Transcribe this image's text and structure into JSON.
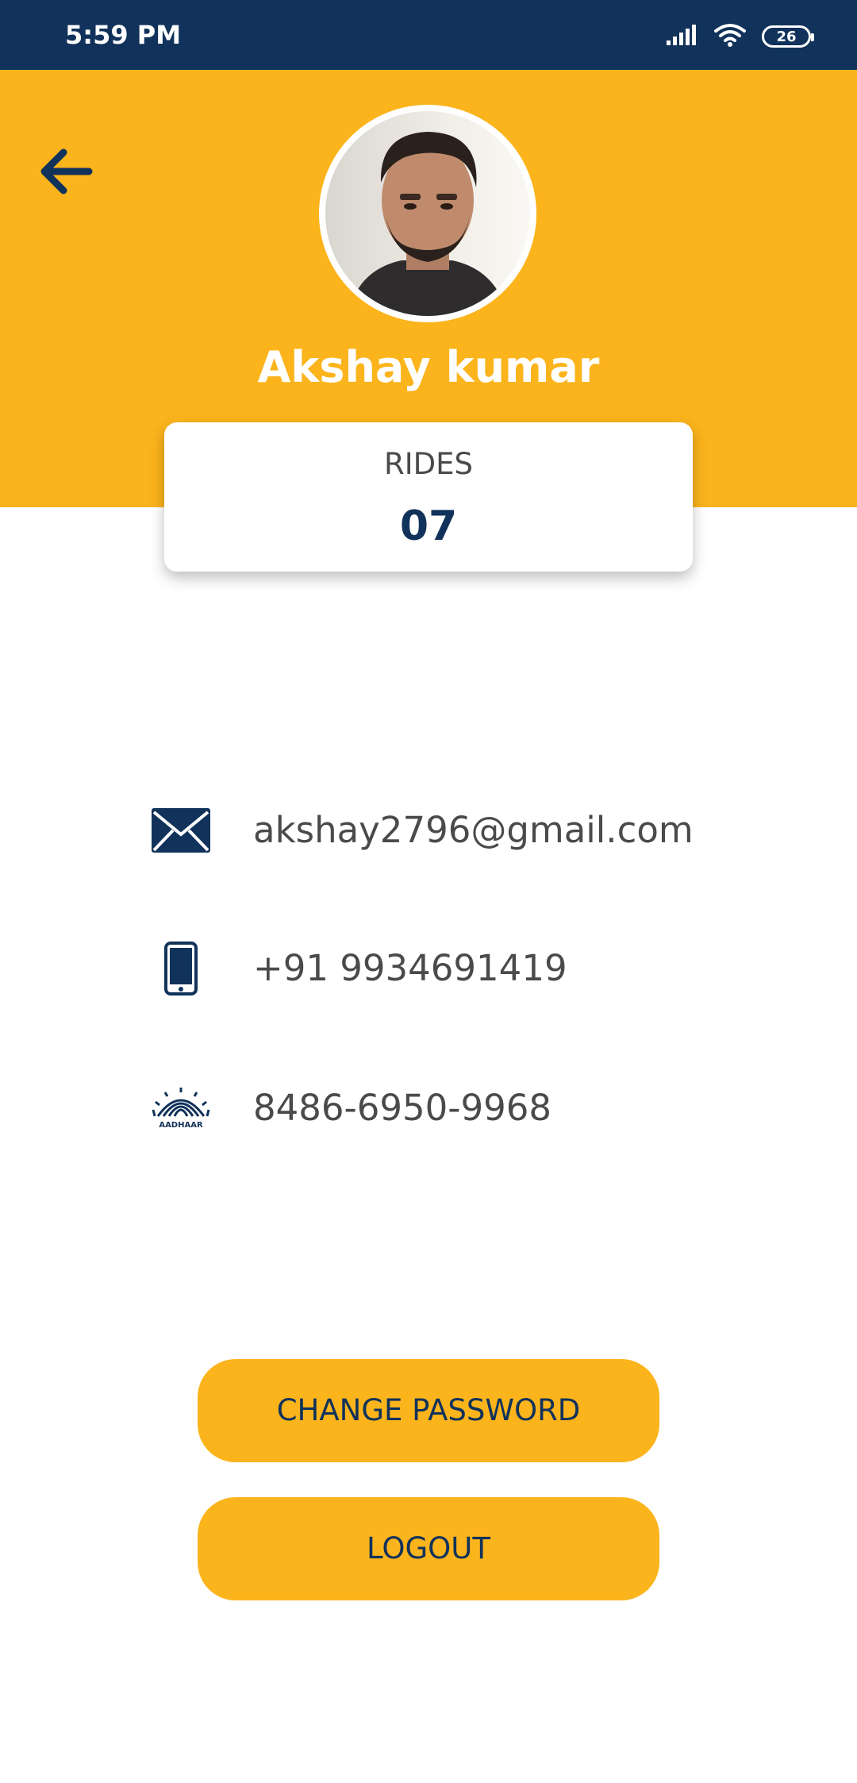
{
  "status_bar": {
    "time": "5:59 PM",
    "battery": "26",
    "icons": [
      "signal-icon",
      "wifi-icon",
      "battery-icon"
    ]
  },
  "header": {
    "back_icon": "arrow-left-icon",
    "name": "Akshay kumar"
  },
  "rides": {
    "label": "RIDES",
    "value": "07"
  },
  "info": {
    "email": {
      "icon": "email-icon",
      "value": "akshay2796@gmail.com"
    },
    "phone": {
      "icon": "phone-icon",
      "value": "+91 9934691419"
    },
    "aadhaar": {
      "icon": "aadhaar-icon",
      "value": "8486-6950-9968",
      "logo_text": "AADHAAR"
    }
  },
  "actions": {
    "change_password": "CHANGE PASSWORD",
    "logout": "LOGOUT"
  },
  "colors": {
    "primary": "#11325a",
    "accent": "#fbb41c",
    "text": "#4a4a4a",
    "background": "#ffffff"
  }
}
